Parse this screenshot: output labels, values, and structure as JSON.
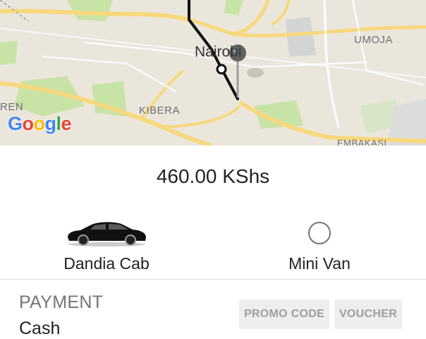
{
  "map": {
    "places": {
      "umoja": "UMOJA",
      "kibera": "KIBERA",
      "partial_left": "REN",
      "embakasi": "EMBAKASI",
      "city": "Nairobi"
    },
    "attribution": [
      "G",
      "o",
      "o",
      "g",
      "l",
      "e"
    ],
    "colors": {
      "road": "#f7d87c",
      "park": "#c8e3a6",
      "route": "#111111",
      "pin": "#616161"
    }
  },
  "fare": {
    "amount": "460.00 KShs"
  },
  "vehicles": [
    {
      "label": "Dandia Cab",
      "icon": "car-icon",
      "selected": true
    },
    {
      "label": "Mini Van",
      "icon": "radio-unselected-icon",
      "selected": false
    }
  ],
  "payment": {
    "heading": "PAYMENT",
    "method": "Cash"
  },
  "actions": {
    "promo_label": "PROMO CODE",
    "voucher_label": "VOUCHER"
  }
}
